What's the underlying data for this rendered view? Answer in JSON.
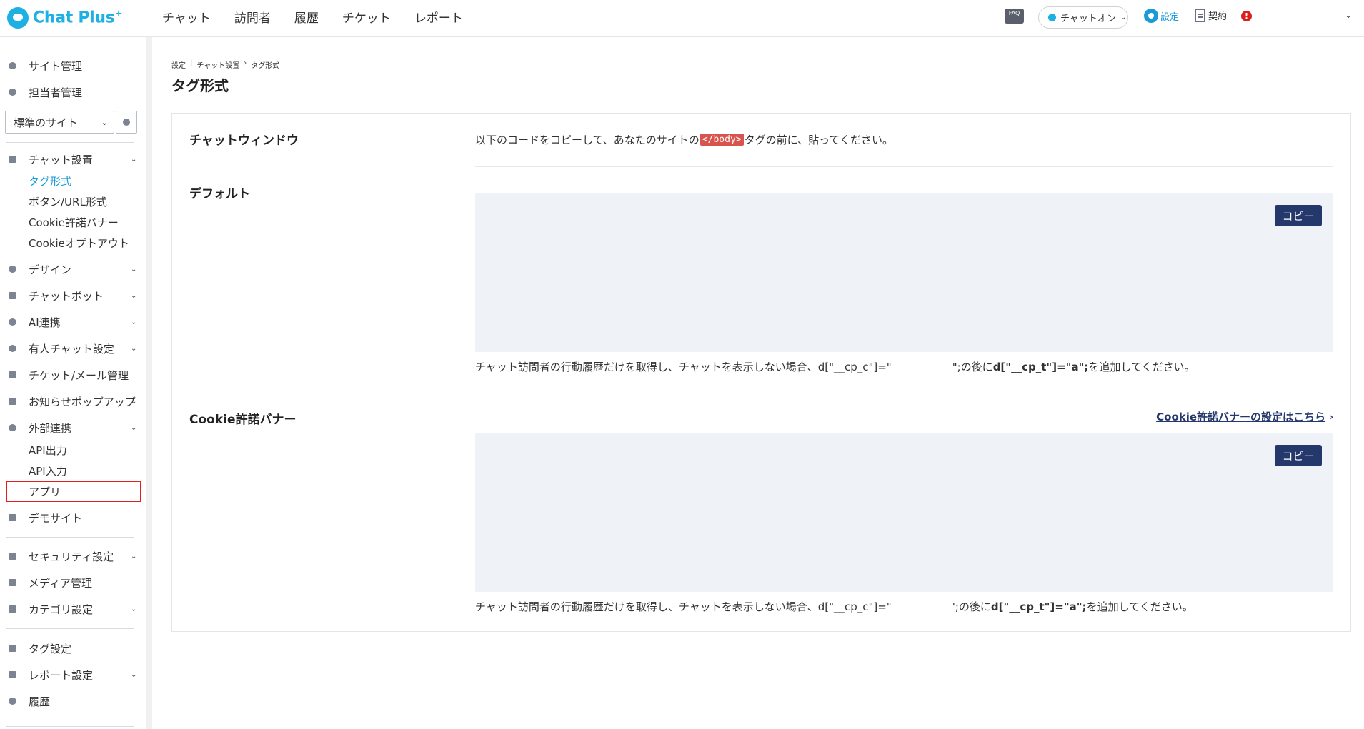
{
  "header": {
    "logo_text": "Chat Plus",
    "logo_sup": "+",
    "nav": [
      "チャット",
      "訪問者",
      "履歴",
      "チケット",
      "レポート"
    ],
    "faq_label": "FAQ",
    "status_label": "チャットオン",
    "settings_label": "設定",
    "contract_label": "契約",
    "alert_label": "!"
  },
  "sidebar": {
    "top_items": [
      "サイト管理",
      "担当者管理"
    ],
    "site_select": "標準のサイト",
    "chat_settings": "チャット設置",
    "chat_settings_sub": [
      "タグ形式",
      "ボタン/URL形式",
      "Cookie許諾バナー",
      "Cookieオプトアウト"
    ],
    "design": "デザイン",
    "chatbot": "チャットボット",
    "ai": "AI連携",
    "manned_chat": "有人チャット設定",
    "ticket_mail": "チケット/メール管理",
    "popup": "お知らせポップアップ",
    "external": "外部連携",
    "external_sub": [
      "API出力",
      "API入力",
      "アプリ"
    ],
    "demo_site": "デモサイト",
    "security": "セキュリティ設定",
    "media": "メディア管理",
    "category": "カテゴリ設定",
    "tag_settings": "タグ設定",
    "report_settings": "レポート設定",
    "history": "履歴"
  },
  "breadcrumb": {
    "part1": "設定",
    "part2": "チャット設置",
    "current": "タグ形式"
  },
  "page_title": "タグ形式",
  "chat_window": {
    "title": "チャットウィンドウ",
    "desc_before": "以下のコードをコピーして、あなたのサイトの",
    "code_tag": "</body>",
    "desc_after": "タグの前に、貼ってください。"
  },
  "default_section": {
    "title": "デフォルト",
    "copy_label": "コピー",
    "note_pre": "チャット訪問者の行動履歴だけを取得し、チャットを表示しない場合、d[\"__cp_c\"]=\"",
    "note_mid": "\";の後に",
    "note_bold": "d[\"__cp_t\"]=\"a\";",
    "note_post": "を追加してください。"
  },
  "cookie_section": {
    "title": "Cookie許諾バナー",
    "link_label": "Cookie許諾バナーの設定はこちら",
    "copy_label": "コピー",
    "note_pre": "チャット訪問者の行動履歴だけを取得し、チャットを表示しない場合、d[\"__cp_c\"]=\"",
    "note_mid": "';の後に",
    "note_bold": "d[\"__cp_t\"]=\"a\";",
    "note_post": "を追加してください。"
  }
}
